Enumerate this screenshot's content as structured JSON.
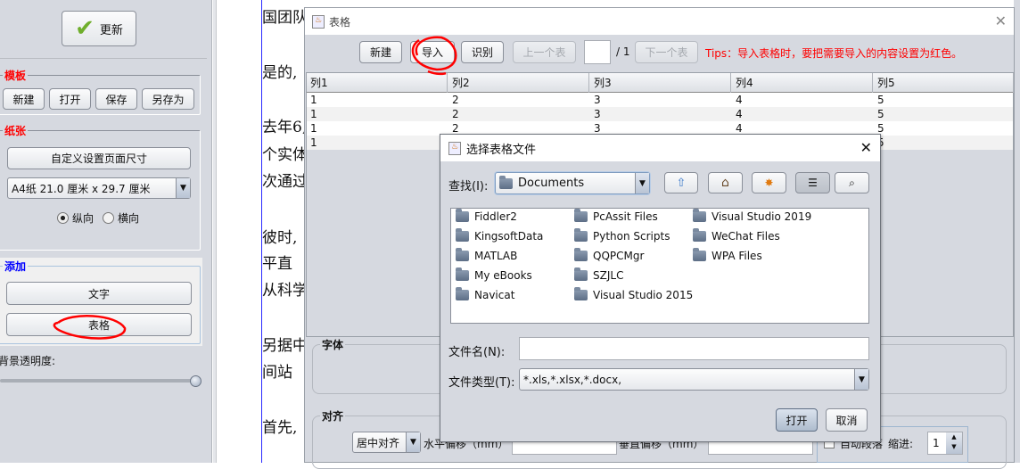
{
  "left_panel": {
    "update_button": "更新",
    "template_group": {
      "title": "模板",
      "buttons": [
        "新建",
        "打开",
        "保存",
        "另存为"
      ]
    },
    "paper_group": {
      "title": "纸张",
      "custom_size_button": "自定义设置页面尺寸",
      "paper_size": "A4纸 21.0 厘米 x 29.7 厘米",
      "orientation": [
        "纵向",
        "横向"
      ],
      "selected_orientation": "纵向"
    },
    "add_group": {
      "title": "添加",
      "text_button": "文字",
      "table_button": "表格"
    },
    "opacity_label": "背景透明度:",
    "opacity_value": 1.0
  },
  "document": {
    "lines": [
      "国团队",
      "是的,",
      "去年6,",
      "个实体",
      "次通过",
      "彼时,",
      "平直",
      "从科学",
      "另据中",
      "间站",
      "首先,"
    ]
  },
  "table_dialog": {
    "title": "表格",
    "toolbar": {
      "new": "新建",
      "import": "导入",
      "recognize": "识别",
      "prev": "上一个表",
      "page_value": "",
      "page_total": "/ 1",
      "next": "下一个表",
      "tips": "Tips：导入表格时，要把需要导入的内容设置为红色。"
    },
    "columns": [
      "列1",
      "列2",
      "列3",
      "列4",
      "列5"
    ],
    "rows": [
      [
        "1",
        "2",
        "3",
        "4",
        "5"
      ],
      [
        "1",
        "2",
        "3",
        "4",
        "5"
      ],
      [
        "1",
        "2",
        "3",
        "4",
        "5"
      ],
      [
        "1",
        "2",
        "3",
        "4",
        "5"
      ]
    ],
    "font_group": "字体",
    "align_group": {
      "title": "对齐",
      "align": "居中对齐",
      "h_offset_label": "水平偏移（mm）",
      "h_offset": "0",
      "v_offset_label": "垂直偏移（mm）",
      "v_offset": "0",
      "auto_label": "自动段落",
      "indent_label": "缩进:",
      "indent": "1"
    }
  },
  "file_dialog": {
    "title": "选择表格文件",
    "look_in_label": "查找(I):",
    "look_in": "Documents",
    "files": [
      "Fiddler2",
      "KingsoftData",
      "MATLAB",
      "My eBooks",
      "Navicat",
      "PcAssit Files",
      "Python Scripts",
      "QQPCMgr",
      "SZJLC",
      "Visual Studio 2015",
      "Visual Studio 2019",
      "WeChat Files",
      "WPA Files"
    ],
    "filename_label": "文件名(N):",
    "filename": "",
    "filetype_label": "文件类型(T):",
    "filetype": "*.xls,*.xlsx,*.docx,",
    "open": "打开",
    "cancel": "取消"
  },
  "colors": {
    "panel": "#d6d9e0",
    "tips": "#ff0000",
    "group_red": "#ff0000",
    "group_blue": "#0000ff",
    "annotation": "#ff0000"
  }
}
